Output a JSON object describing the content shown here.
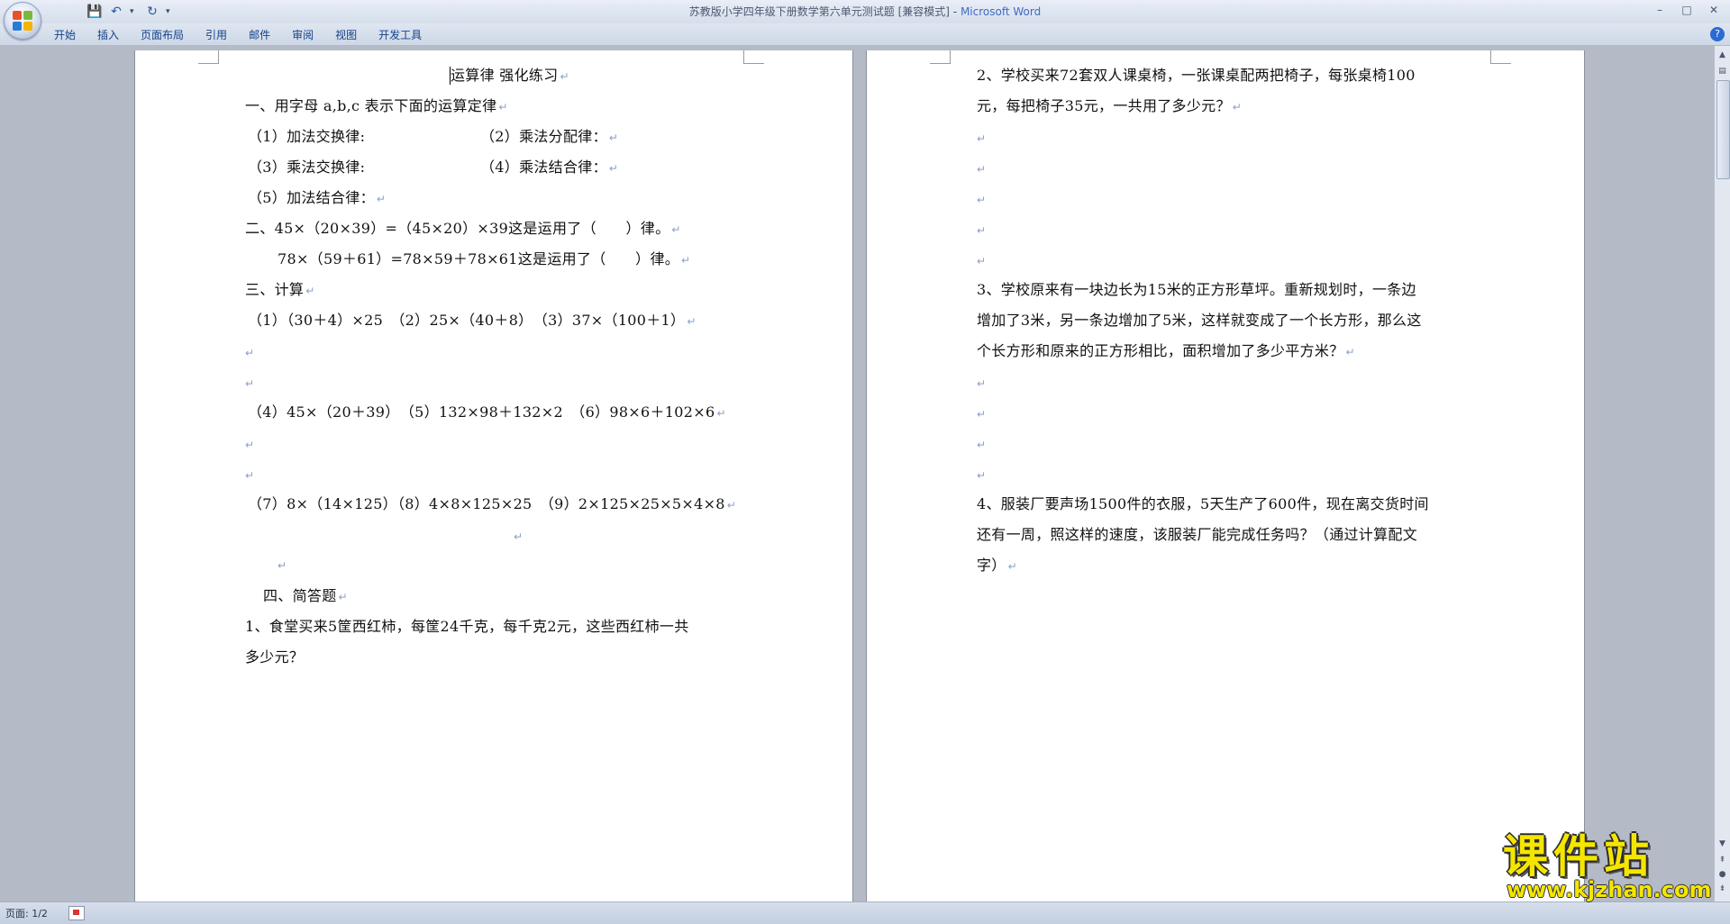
{
  "titlebar": {
    "doc_title": "苏教版小学四年级下册数学第六单元测试题 [兼容模式]",
    "separator": " - ",
    "app_name": "Microsoft Word"
  },
  "window_controls": {
    "minimize": "–",
    "maximize": "□",
    "close": "✕"
  },
  "quick_access": {
    "save": "💾",
    "undo": "↶",
    "redo": "↻",
    "dropdown": "▾"
  },
  "ribbon_tabs": [
    "开始",
    "插入",
    "页面布局",
    "引用",
    "邮件",
    "审阅",
    "视图",
    "开发工具"
  ],
  "help": "?",
  "colors": {
    "office_logo": [
      "#e8502b",
      "#7cb83a",
      "#2a7bd6",
      "#f4b400"
    ]
  },
  "paragraph_mark": "↵",
  "page1": {
    "title": "运算律 强化练习",
    "s1_heading": "一、用字母 a,b,c 表示下面的运算定律",
    "s1_q1": "（1）加法交换律:",
    "s1_q2": "（2）乘法分配律：",
    "s1_q3": "（3）乘法交换律:",
    "s1_q4": "（4）乘法结合律：",
    "s1_q5": "（5）加法结合律：",
    "s2_line1": "二、45×（20×39）=（45×20）×39这是运用了（　　）律。",
    "s2_line2": "78×（59＋61）=78×59＋78×61这是运用了（　　）律。",
    "s3_heading": "三、计算",
    "s3_row1": "（1）（30＋4）×25　（2）25×（40＋8）　（3）37×（100＋1）",
    "s3_row2": "（4）45×（20＋39）　（5）132×98＋132×2　（6）98×6＋102×6",
    "s3_row3": "（7）8×（14×125）（8）4×8×125×25　（9）2×125×25×5×4×8",
    "s4_heading": "四、简答题",
    "s4_q1_line1": "1、食堂买来5筐西红柿，每筐24千克，每千克2元，这些西红柿一共",
    "s4_q1_line2": "多少元？"
  },
  "page2": {
    "q2_line1": "2、学校买来72套双人课桌椅，一张课桌配两把椅子，每张桌椅100",
    "q2_line2": "元，每把椅子35元，一共用了多少元？",
    "q3_line1": "3、学校原来有一块边长为15米的正方形草坪。重新规划时，一条边",
    "q3_line2": "增加了3米，另一条边增加了5米，这样就变成了一个长方形，那么这",
    "q3_line3": "个长方形和原来的正方形相比，面积增加了多少平方米？",
    "q4_line1": "4、服装厂要声场1500件的衣服，5天生产了600件，现在离交货时间",
    "q4_line2": "还有一周，照这样的速度，该服装厂能完成任务吗？（通过计算配文",
    "q4_line3": "字）"
  },
  "statusbar": {
    "page_info": "页面: 1/2"
  },
  "watermark": {
    "text": "课件站",
    "url": "www.kjzhan.com"
  }
}
